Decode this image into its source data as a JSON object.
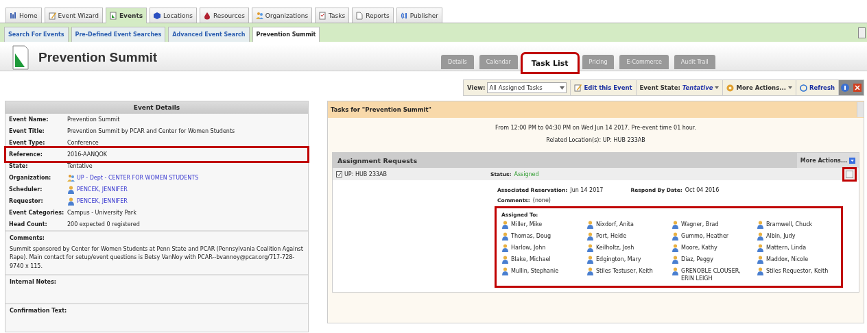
{
  "main_tabs": [
    {
      "label": "Home",
      "selected": false
    },
    {
      "label": "Event Wizard",
      "selected": false
    },
    {
      "label": "Events",
      "selected": true
    },
    {
      "label": "Locations",
      "selected": false
    },
    {
      "label": "Resources",
      "selected": false
    },
    {
      "label": "Organizations",
      "selected": false
    },
    {
      "label": "Tasks",
      "selected": false
    },
    {
      "label": "Reports",
      "selected": false
    },
    {
      "label": "Publisher",
      "selected": false
    }
  ],
  "sub_tabs": [
    {
      "label": "Search For Events",
      "selected": false
    },
    {
      "label": "Pre-Defined Event Searches",
      "selected": false
    },
    {
      "label": "Advanced Event Search",
      "selected": false
    },
    {
      "label": "Prevention Summit",
      "selected": true
    }
  ],
  "page_title": "Prevention Summit",
  "event_tabs": [
    {
      "label": "Details",
      "selected": false,
      "highlighted": false
    },
    {
      "label": "Calendar",
      "selected": false,
      "highlighted": false
    },
    {
      "label": "Task List",
      "selected": true,
      "highlighted": true
    },
    {
      "label": "Pricing",
      "selected": false,
      "highlighted": false
    },
    {
      "label": "E-Commerce",
      "selected": false,
      "highlighted": false
    },
    {
      "label": "Audit Trail",
      "selected": false,
      "highlighted": false
    }
  ],
  "toolbar": {
    "view_label": "View:",
    "view_value": "All Assigned Tasks",
    "edit": "Edit this Event",
    "state_label": "Event State:",
    "state_value": "Tentative",
    "more_actions": "More Actions...",
    "refresh": "Refresh"
  },
  "event_details": {
    "title": "Event Details",
    "fields": [
      {
        "label": "Event Name:",
        "value": "Prevention Summit",
        "kind": "text",
        "highlighted": false
      },
      {
        "label": "Event Title:",
        "value": "Prevention Summit by PCAR and Center for Women Students",
        "kind": "text",
        "highlighted": false
      },
      {
        "label": "Event Type:",
        "value": "Conference",
        "kind": "text",
        "highlighted": false
      },
      {
        "label": "Reference:",
        "value": "2016-AANQOK",
        "kind": "text",
        "highlighted": true
      },
      {
        "label": "State:",
        "value": "Tentative",
        "kind": "text",
        "highlighted": false
      },
      {
        "label": "Organization:",
        "value": "UP - Dept - CENTER FOR WOMEN STUDENTS",
        "kind": "organization",
        "highlighted": false
      },
      {
        "label": "Scheduler:",
        "value": "PENCEK, JENNIFER",
        "kind": "person",
        "highlighted": false
      },
      {
        "label": "Requestor:",
        "value": "PENCEK, JENNIFER",
        "kind": "person",
        "highlighted": false
      },
      {
        "label": "Event Categories:",
        "value": "Campus - University Park",
        "kind": "text",
        "highlighted": false
      },
      {
        "label": "Head Count:",
        "value": "200 expected   0 registered",
        "kind": "text",
        "highlighted": false
      }
    ],
    "sections": [
      {
        "label": "Comments:",
        "text": "Summit sponsored by Center for Women Students at Penn State and PCAR (Pennsylvania Coalition Against Rape). Main contact for setup/event questions is Betsy VanNoy with PCAR--bvannoy@pcar.org/717-728-9740 x 115."
      },
      {
        "label": "Internal Notes:"
      },
      {
        "label": "Confirmation Text:"
      }
    ]
  },
  "tasks_panel": {
    "title": "Tasks for \"Prevention Summit\"",
    "time_info": "From 12:00 PM to 04:30 PM on Wed Jun 14 2017. Pre-event time 01 hour.",
    "locations": "Related Location(s): UP: HUB 233AB",
    "assignment": {
      "title": "Assignment Requests",
      "more_actions": "More Actions...",
      "item": "UP: HUB 233AB",
      "collapse_highlighted": true,
      "status_label": "Status:",
      "status_value": "Assigned",
      "reservation_label": "Associated Reservation:",
      "reservation_value": "Jun 14 2017",
      "respond_label": "Respond By Date:",
      "respond_value": "Oct 04 2016",
      "comments_label": "Comments:",
      "comments_value": "(none)",
      "assigned_label": "Assigned To:",
      "assigned_highlighted": true,
      "assignees": [
        "Miller, Mike",
        "Nixdorf, Anita",
        "Wagner, Brad",
        "Bramwell, Chuck",
        "Thomas, Doug",
        "Port, Heide",
        "Gummo, Heather",
        "Albin, Judy",
        "Harlow, John",
        "Keilholtz, Josh",
        "Moore, Kathy",
        "Mattern, Linda",
        "Blake, Michael",
        "Edgington, Mary",
        "Diaz, Peggy",
        "Maddox, Nicole",
        "Mullin, Stephanie",
        "Stiles Testuser, Keith",
        "GRENOBLE CLOUSER, ERIN LEIGH",
        "Stiles Requestor, Keith"
      ]
    }
  }
}
